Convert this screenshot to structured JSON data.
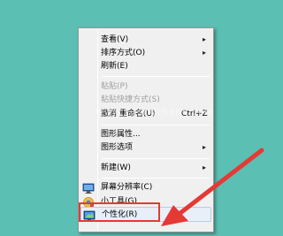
{
  "menu": {
    "items": [
      {
        "label": "查看(V)",
        "submenu": true
      },
      {
        "label": "排序方式(O)",
        "submenu": true
      },
      {
        "label": "刷新(E)"
      },
      {
        "label": "粘贴(P)",
        "disabled": true
      },
      {
        "label": "粘贴快捷方式(S)",
        "disabled": true
      },
      {
        "label": "撤消 重命名(U)",
        "shortcut": "Ctrl+Z"
      },
      {
        "label": "图形属性..."
      },
      {
        "label": "图形选项",
        "submenu": true
      },
      {
        "label": "新建(W)",
        "submenu": true
      },
      {
        "label": "屏幕分辨率(C)"
      },
      {
        "label": "小工具(G)"
      },
      {
        "label": "个性化(R)"
      }
    ],
    "submenu_arrow": "▸"
  },
  "watermark": "www.xitongcheng.com",
  "colors": {
    "desktop": "#5bbfb3",
    "annotation_red": "#e53935"
  },
  "icons": {
    "screen_resolution": "monitor-icon",
    "gadgets": "gadgets-icon",
    "personalize": "personalize-icon"
  }
}
